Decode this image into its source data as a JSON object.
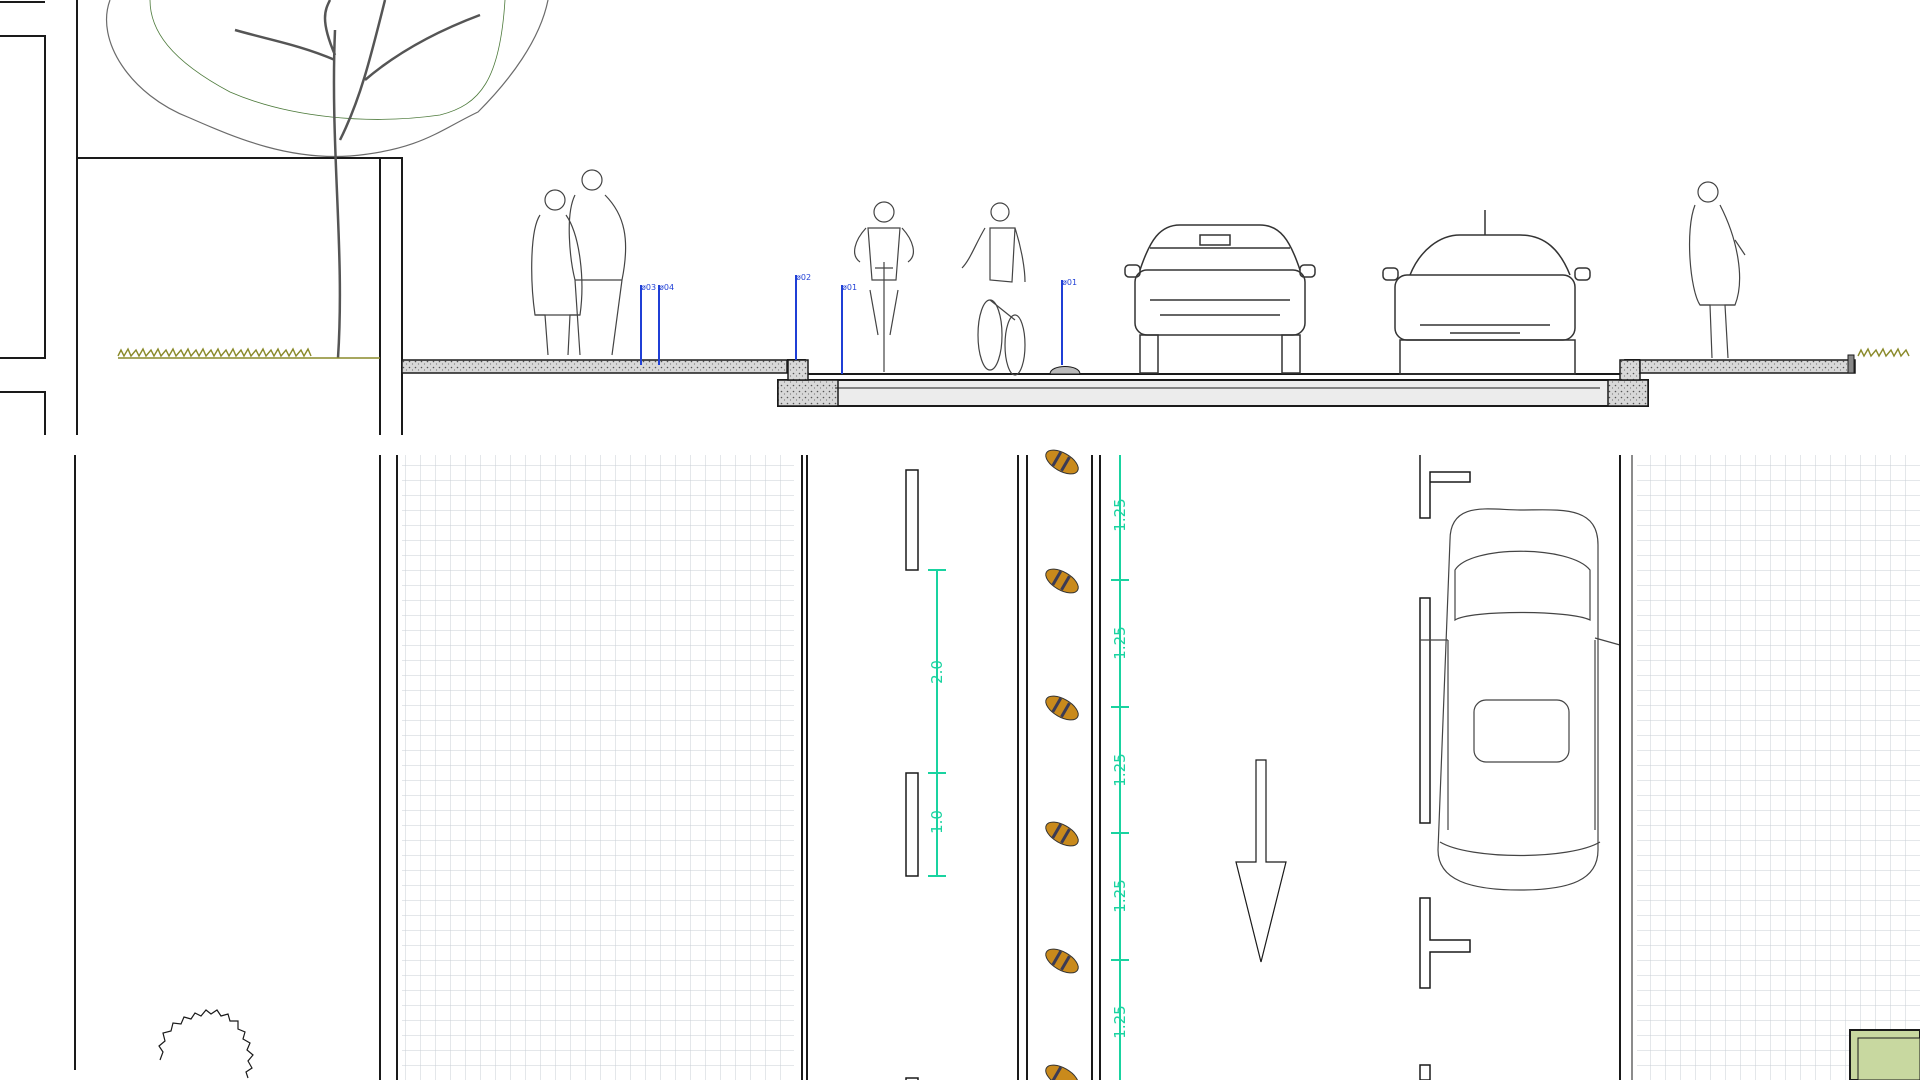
{
  "drawing": {
    "section_markers": [
      "ø03",
      "ø04",
      "ø02",
      "ø01",
      "ø01"
    ],
    "bollard_dims": [
      "2.0",
      "1.0"
    ],
    "marker_dims": [
      "1.25",
      "1.25",
      "1.25",
      "1.25",
      "1.25"
    ]
  },
  "colors": {
    "line": "#1a1a1a",
    "grid": "#c9cfd6",
    "dimension": "#19d3a0",
    "marker": "#1f3fd6",
    "road_marker_fill": "#c98a1c",
    "road_marker_stripe": "#3b3b55",
    "grass": "#8a8a2a",
    "planter": "#c8d8a0"
  },
  "icons": [
    "tree-elevation-icon",
    "pedestrian-couple-icon",
    "cyclist-front-icon",
    "cyclist-side-icon",
    "car-front-icon",
    "car-front-icon",
    "standing-man-icon",
    "car-top-view-icon",
    "arrow-down-icon",
    "shrub-plan-icon"
  ]
}
